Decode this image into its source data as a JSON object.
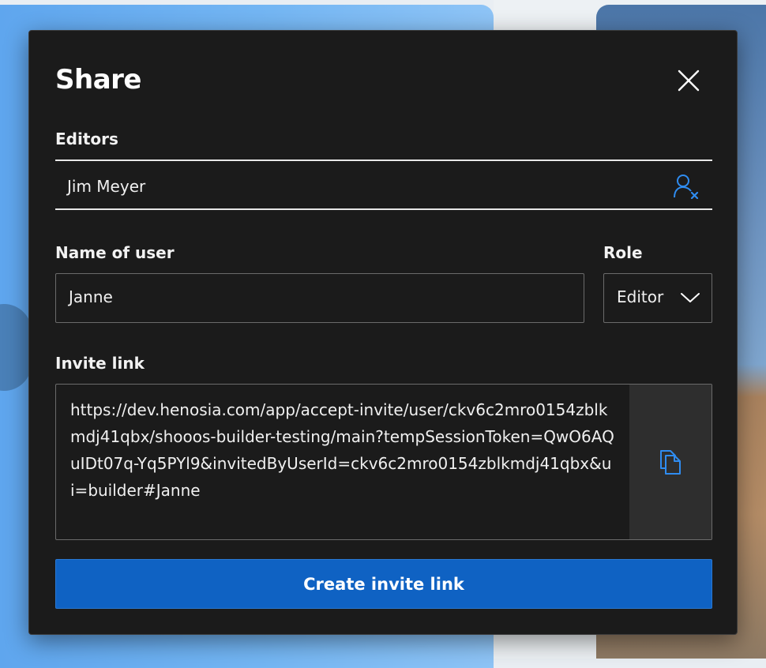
{
  "dialog": {
    "title": "Share",
    "close_icon": "close-icon"
  },
  "editors": {
    "label": "Editors",
    "items": [
      {
        "name": "Jim Meyer",
        "remove_icon": "remove-user-icon"
      }
    ]
  },
  "name_of_user": {
    "label": "Name of user",
    "value": "Janne"
  },
  "role": {
    "label": "Role",
    "selected": "Editor",
    "icon": "chevron-down-icon"
  },
  "invite_link": {
    "label": "Invite link",
    "value": "https://dev.henosia.com/app/accept-invite/user/ckv6c2mro0154zblkmdj41qbx/shooos-builder-testing/main?tempSessionToken=QwO6AQuIDt07q-Yq5PYl9&invitedByUserId=ckv6c2mro0154zblkmdj41qbx&ui=builder#Janne",
    "copy_icon": "copy-icon"
  },
  "actions": {
    "create_label": "Create invite link"
  },
  "colors": {
    "accent": "#0f62c3",
    "icon_accent": "#2f8cf0",
    "dialog_bg": "#1b1b1b"
  }
}
